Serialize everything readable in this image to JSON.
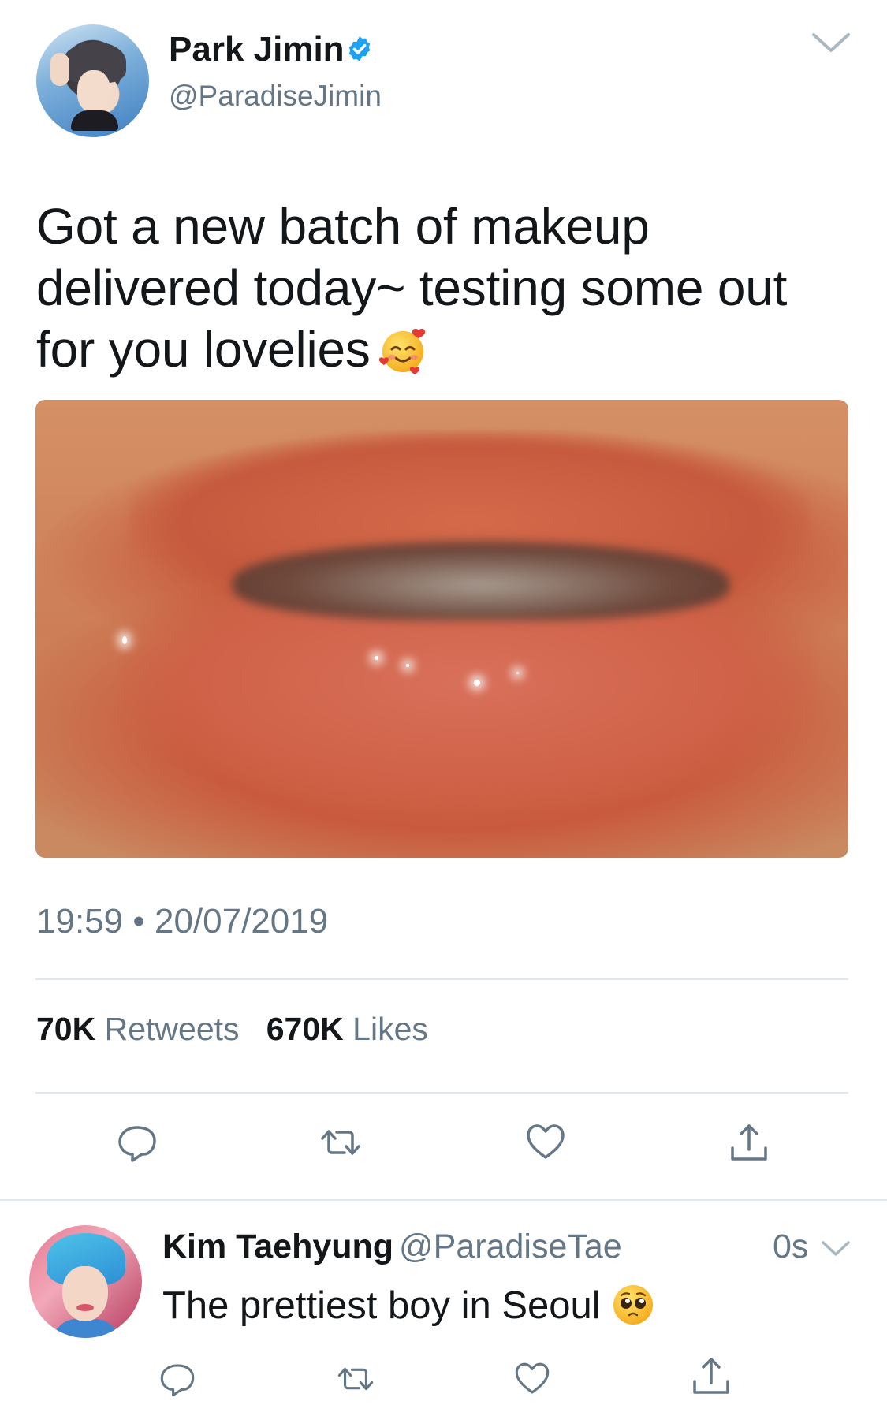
{
  "tweet": {
    "author_name": "Park Jimin",
    "author_handle": "@ParadiseJimin",
    "verified": true,
    "text": "Got a new batch of makeup delivered today~ testing some out for you lovelies",
    "emoji": "smiling-face-with-hearts",
    "time": "19:59",
    "separator": "•",
    "date": "20/07/2019",
    "retweets_count": "70K",
    "retweets_label": "Retweets",
    "likes_count": "670K",
    "likes_label": "Likes"
  },
  "reply": {
    "author_name": "Kim Taehyung",
    "author_handle": "@ParadiseTae",
    "time": "0s",
    "text": "The prettiest boy in Seoul",
    "emoji": "pleading-face"
  },
  "colors": {
    "text_primary": "#14171a",
    "text_secondary": "#657786",
    "verified_blue": "#1da1f2",
    "divider": "#e1e8ed",
    "icon_gray": "#657786"
  },
  "icons": [
    "verified-badge-icon",
    "chevron-down-icon",
    "reply-icon",
    "retweet-icon",
    "like-icon",
    "share-icon"
  ]
}
